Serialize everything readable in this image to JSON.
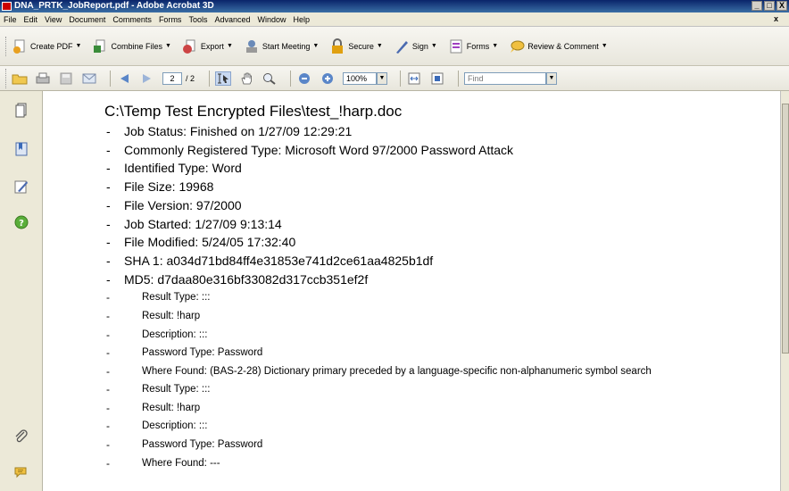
{
  "window": {
    "title": "DNA_PRTK_JobReport.pdf - Adobe Acrobat 3D",
    "controls": [
      "_",
      "□",
      "X"
    ]
  },
  "menu": [
    "File",
    "Edit",
    "View",
    "Document",
    "Comments",
    "Forms",
    "Tools",
    "Advanced",
    "Window",
    "Help"
  ],
  "task_toolbar": {
    "create_pdf": "Create PDF",
    "combine_files": "Combine Files",
    "export": "Export",
    "start_meeting": "Start Meeting",
    "secure": "Secure",
    "sign": "Sign",
    "forms": "Forms",
    "review_comment": "Review & Comment"
  },
  "nav_toolbar": {
    "current_page": "2",
    "of_pages": "/ 2",
    "zoom": "100%",
    "find_placeholder": "Find"
  },
  "document": {
    "heading": "C:\\Temp Test Encrypted Files\\test_!harp.doc",
    "items": [
      "Job Status: Finished on 1/27/09 12:29:21",
      "Commonly Registered Type: Microsoft Word 97/2000 Password Attack",
      "Identified Type: Word",
      "File Size: 19968",
      "File Version: 97/2000",
      "Job Started: 1/27/09 9:13:14",
      "File Modified: 5/24/05 17:32:40",
      "SHA 1: a034d71bd84ff4e31853e741d2ce61aa4825b1df",
      "MD5: d7daa80e316bf33082d317ccb351ef2f"
    ],
    "results": [
      "Result Type: :::",
      "Result: !harp",
      "Description: :::",
      "Password Type: Password",
      "Where Found: (BAS-2-28) Dictionary primary preceded by a language-specific non-alphanumeric symbol search",
      "Result Type: :::",
      "Result: !harp",
      "Description: :::",
      "Password Type: Password",
      "Where Found: ---"
    ],
    "dash": "-"
  }
}
